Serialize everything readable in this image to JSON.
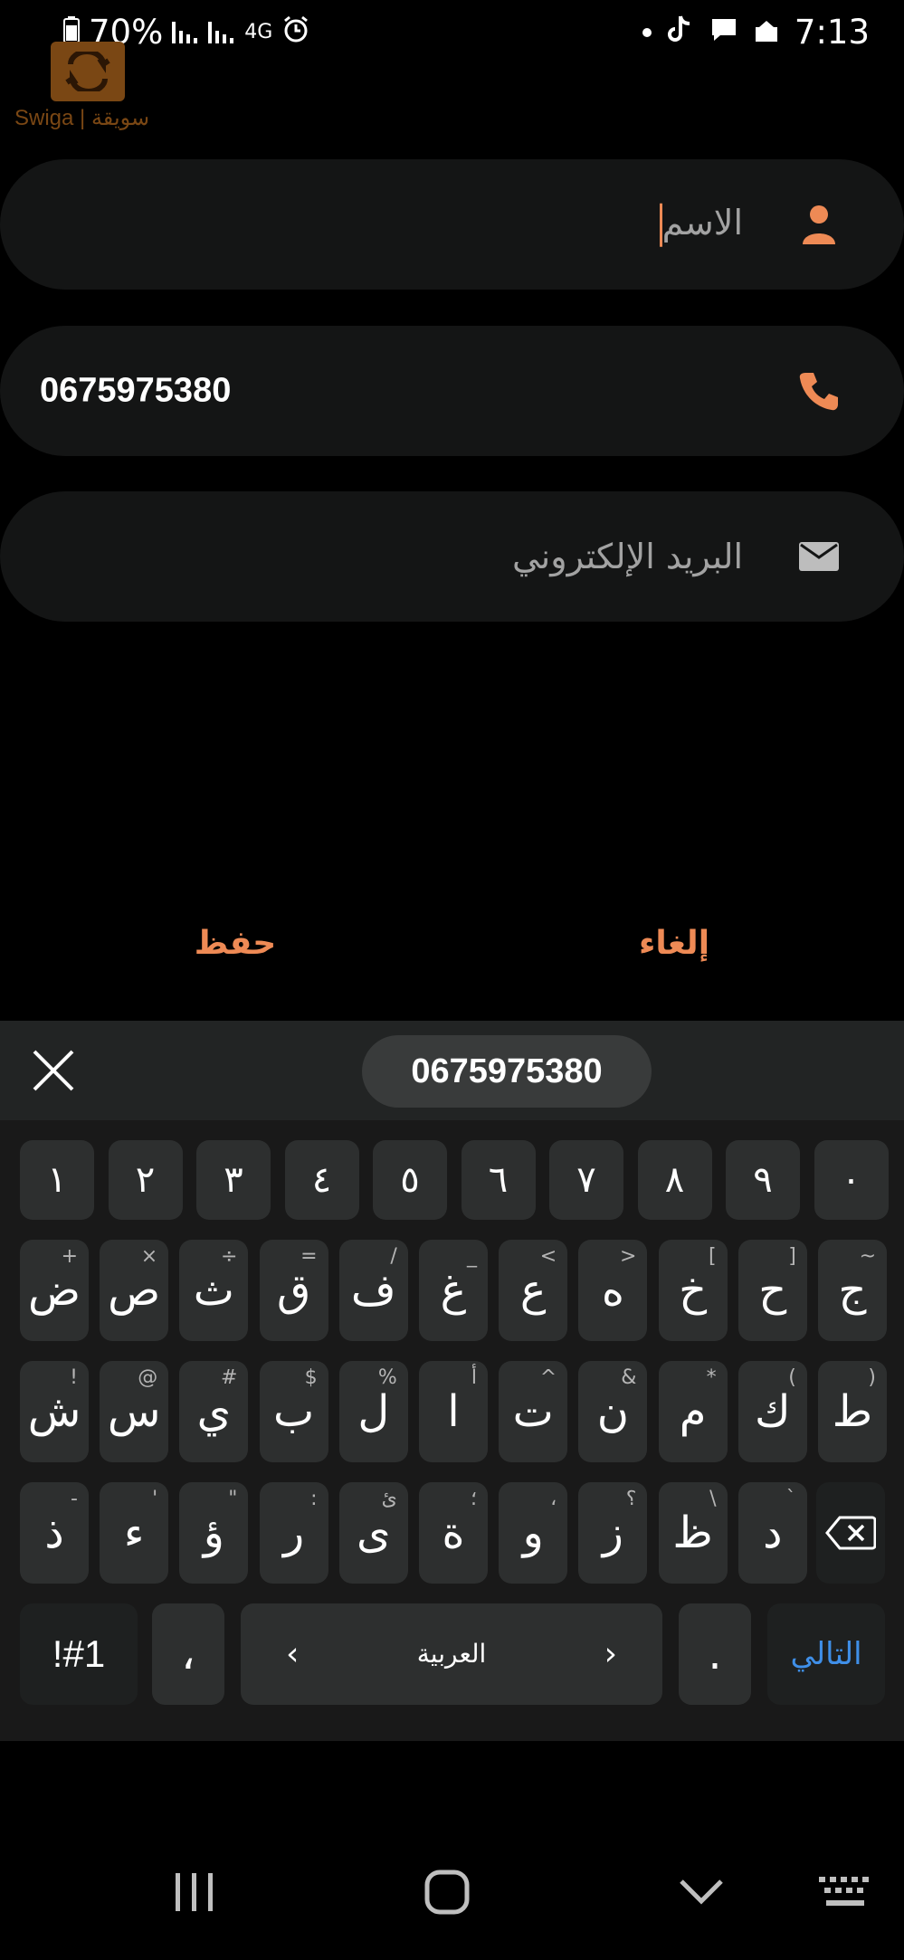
{
  "status_bar": {
    "battery": "70%",
    "network": "4G",
    "time": "7:13"
  },
  "logo": {
    "text": "Swiga | سويقة"
  },
  "form": {
    "name_placeholder": "الاسم",
    "phone_value": "0675975380",
    "email_placeholder": "البريد الإلكتروني"
  },
  "actions": {
    "save_label": "حفظ",
    "cancel_label": "إلغاء"
  },
  "keyboard": {
    "suggestion": "0675975380",
    "number_row": [
      "١",
      "٢",
      "٣",
      "٤",
      "٥",
      "٦",
      "٧",
      "٨",
      "٩",
      "٠"
    ],
    "row1": [
      {
        "main": "ض",
        "hint": "+"
      },
      {
        "main": "ص",
        "hint": "×"
      },
      {
        "main": "ث",
        "hint": "÷"
      },
      {
        "main": "ق",
        "hint": "="
      },
      {
        "main": "ف",
        "hint": "/"
      },
      {
        "main": "غ",
        "hint": "_"
      },
      {
        "main": "ع",
        "hint": "<"
      },
      {
        "main": "ه",
        "hint": ">"
      },
      {
        "main": "خ",
        "hint": "["
      },
      {
        "main": "ح",
        "hint": "]"
      },
      {
        "main": "ج",
        "hint": "~"
      }
    ],
    "row2": [
      {
        "main": "ش",
        "hint": "!"
      },
      {
        "main": "س",
        "hint": "@"
      },
      {
        "main": "ي",
        "hint": "#"
      },
      {
        "main": "ب",
        "hint": "$"
      },
      {
        "main": "ل",
        "hint": "%"
      },
      {
        "main": "ا",
        "hint": "أ"
      },
      {
        "main": "ت",
        "hint": "^"
      },
      {
        "main": "ن",
        "hint": "&"
      },
      {
        "main": "م",
        "hint": "*"
      },
      {
        "main": "ك",
        "hint": "("
      },
      {
        "main": "ط",
        "hint": ")"
      }
    ],
    "row3": [
      {
        "main": "ذ",
        "hint": "-"
      },
      {
        "main": "ء",
        "hint": "'"
      },
      {
        "main": "ؤ",
        "hint": "\""
      },
      {
        "main": "ر",
        "hint": ":"
      },
      {
        "main": "ى",
        "hint": "ئ"
      },
      {
        "main": "ة",
        "hint": "؛"
      },
      {
        "main": "و",
        "hint": "،"
      },
      {
        "main": "ز",
        "hint": "؟"
      },
      {
        "main": "ظ",
        "hint": "\\"
      },
      {
        "main": "د",
        "hint": "`"
      }
    ],
    "symbols_label": "!#1",
    "comma_label": "،",
    "space_label": "العربية",
    "period_label": ".",
    "next_label": "التالي"
  }
}
